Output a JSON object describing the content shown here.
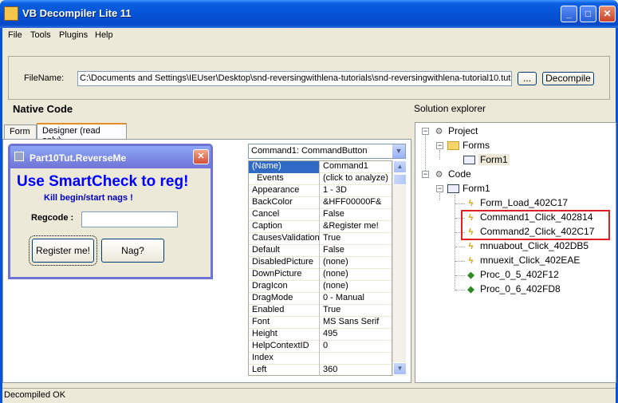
{
  "window": {
    "title": "VB Decompiler Lite 11"
  },
  "menu": [
    "File",
    "Tools",
    "Plugins",
    "Help"
  ],
  "file": {
    "label": "FileName:",
    "path": "C:\\Documents and Settings\\IEUser\\Desktop\\snd-reversingwithlena-tutorials\\snd-reversingwithlena-tutorial10.tut",
    "browse_label": "...",
    "decompile_label": "Decompile"
  },
  "labels": {
    "native_code": "Native Code",
    "solution_explorer": "Solution explorer"
  },
  "tabs": [
    "Form",
    "Designer (read only)"
  ],
  "designer_form": {
    "title": "Part10Tut.ReverseMe",
    "big_text": "Use SmartCheck to reg!",
    "small_text": "Kill begin/start nags !",
    "regcode_label": "Regcode :",
    "register_button": "Register me!",
    "nag_button": "Nag?"
  },
  "properties": {
    "object": "Command1: CommandButton",
    "rows": [
      [
        "(Name)",
        "Command1"
      ],
      [
        "Events",
        "(click to analyze)"
      ],
      [
        "Appearance",
        "1 - 3D"
      ],
      [
        "BackColor",
        "&HFF00000F&"
      ],
      [
        "Cancel",
        "False"
      ],
      [
        "Caption",
        "&Register me!"
      ],
      [
        "CausesValidation",
        "True"
      ],
      [
        "Default",
        "False"
      ],
      [
        "DisabledPicture",
        "(none)"
      ],
      [
        "DownPicture",
        "(none)"
      ],
      [
        "DragIcon",
        "(none)"
      ],
      [
        "DragMode",
        "0 - Manual"
      ],
      [
        "Enabled",
        "True"
      ],
      [
        "Font",
        "MS Sans Serif"
      ],
      [
        "Height",
        "495"
      ],
      [
        "HelpContextID",
        "0"
      ],
      [
        "Index",
        ""
      ],
      [
        "Left",
        "360"
      ]
    ]
  },
  "tree": {
    "project": "Project",
    "forms": "Forms",
    "form1_forms": "Form1",
    "code": "Code",
    "form1_code": "Form1",
    "procs": [
      {
        "name": "Form_Load_402C17",
        "icon": "lightning-icon"
      },
      {
        "name": "Command1_Click_402814",
        "icon": "lightning-icon"
      },
      {
        "name": "Command2_Click_402C17",
        "icon": "lightning-icon"
      },
      {
        "name": "mnuabout_Click_402DB5",
        "icon": "lightning-icon"
      },
      {
        "name": "mnuexit_Click_402EAE",
        "icon": "lightning-icon"
      },
      {
        "name": "Proc_0_5_402F12",
        "icon": "procedure-icon"
      },
      {
        "name": "Proc_0_6_402FD8",
        "icon": "procedure-icon"
      }
    ]
  },
  "status": "Decompiled OK",
  "colors": {
    "titlebar": "#0553d6",
    "highlight": "#e02020",
    "big_text": "#0000ff",
    "selection": "#316ac5"
  }
}
